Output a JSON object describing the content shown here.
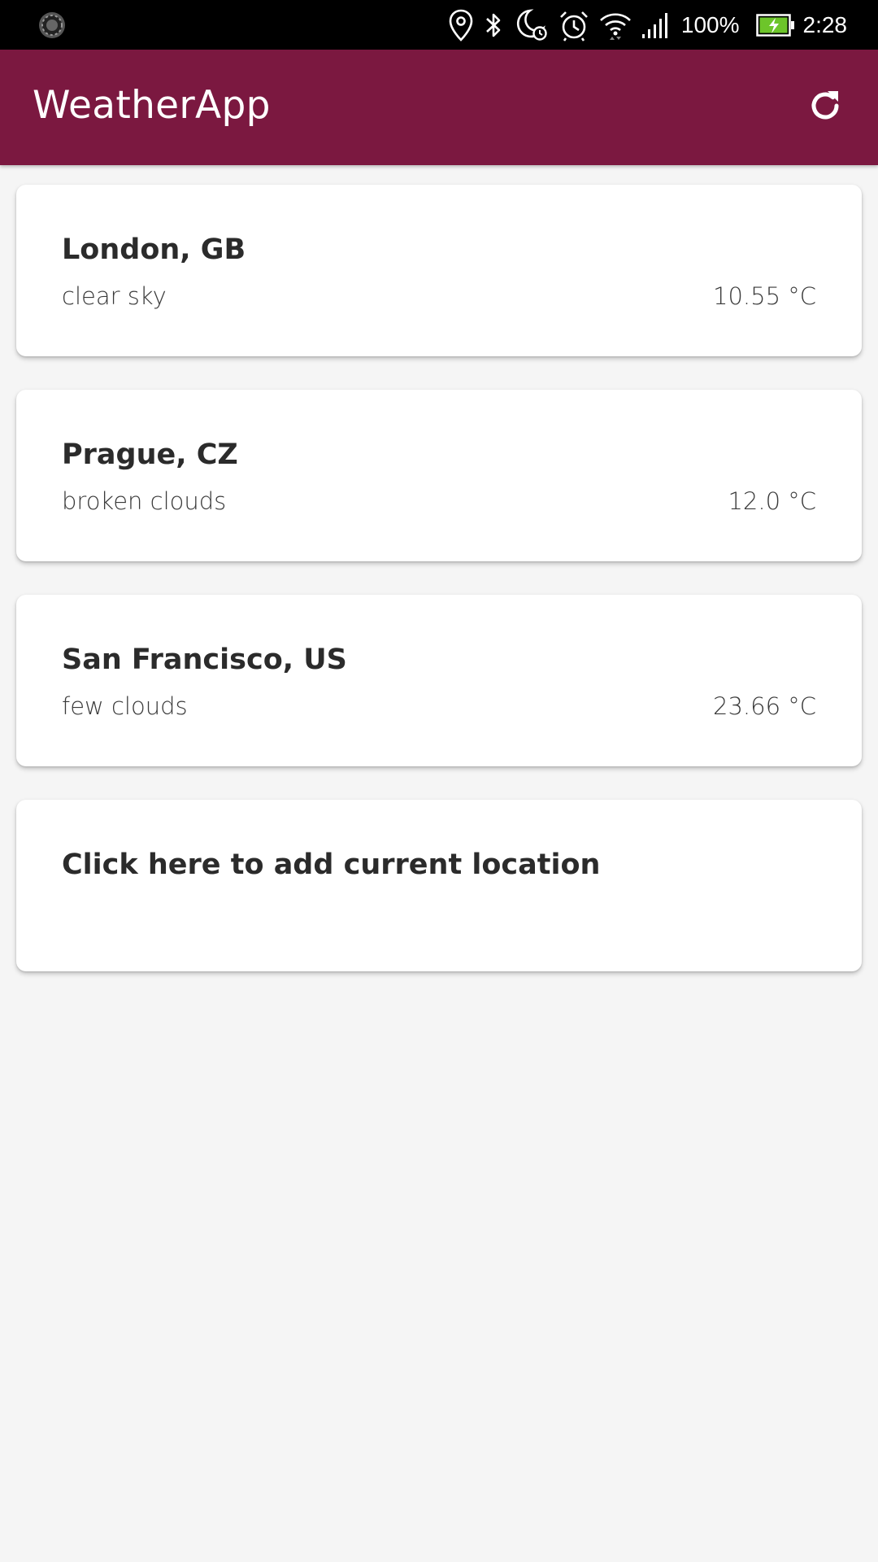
{
  "status_bar": {
    "battery_percent": "100%",
    "time": "2:28",
    "icons": [
      "sync-spinner-icon",
      "location-pin-icon",
      "bluetooth-icon",
      "do-not-disturb-alarm-icon",
      "alarm-clock-icon",
      "wifi-icon",
      "cell-signal-icon",
      "battery-charging-icon"
    ]
  },
  "app_bar": {
    "title": "WeatherApp",
    "refresh_icon": "refresh-icon",
    "color": "#7b1840"
  },
  "cities": [
    {
      "name": "London, GB",
      "description": "clear sky",
      "temperature": "10.55 °C"
    },
    {
      "name": "Prague, CZ",
      "description": "broken clouds",
      "temperature": "12.0 °C"
    },
    {
      "name": "San Francisco, US",
      "description": "few clouds",
      "temperature": "23.66 °C"
    }
  ],
  "add_location": {
    "label": "Click here to add current location"
  }
}
